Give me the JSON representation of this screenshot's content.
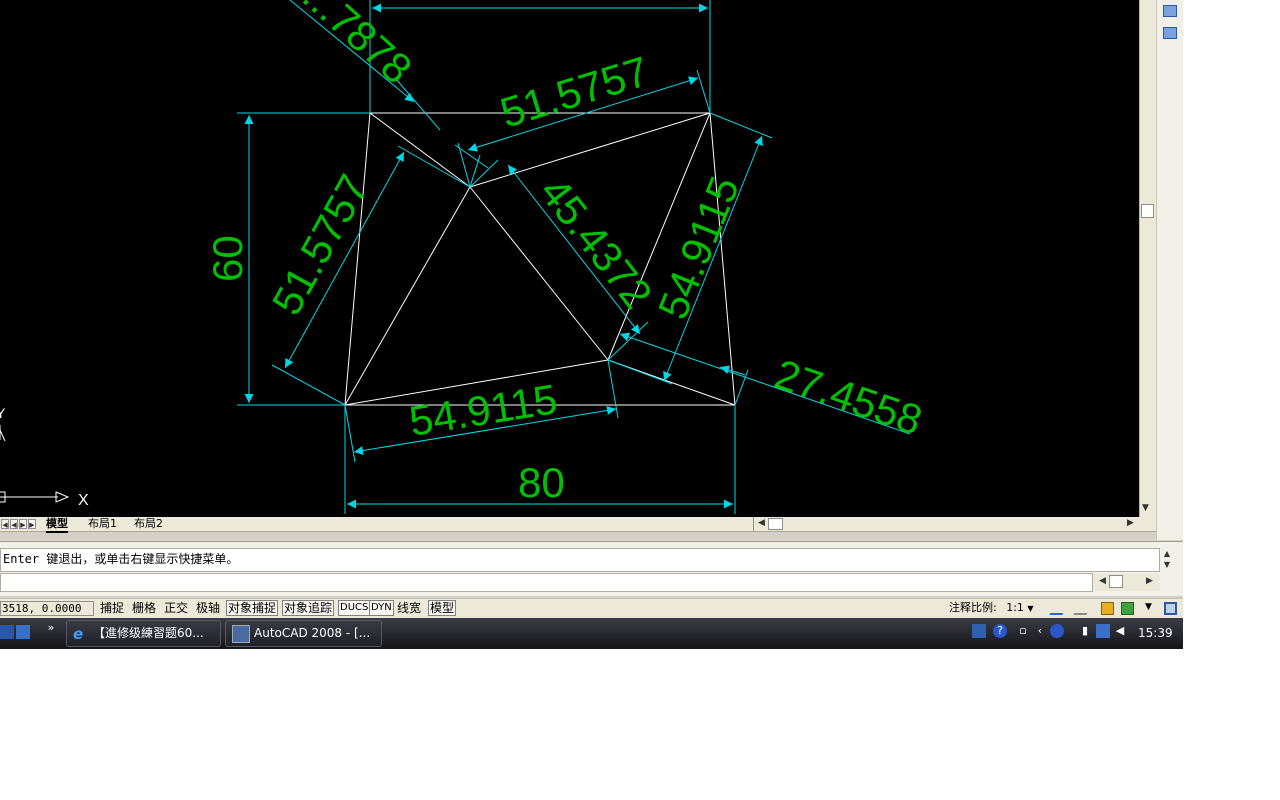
{
  "drawing": {
    "dimensions": {
      "top_partial": "...7878",
      "top_diagonal": "51.5757",
      "left_vertical": "60",
      "left_diagonal": "51.5757",
      "center_diagonal": "45.4372",
      "right_diagonal": "54.9115",
      "right_outer": "27.4558",
      "bottom_diagonal": "54.9115",
      "bottom_width": "80"
    },
    "ucs_x_label": "X",
    "ucs_y_label": "Y"
  },
  "layout_tabs": [
    "模型",
    "布局1",
    "布局2"
  ],
  "command": {
    "line1": "Enter 键退出，或单击右键显示快捷菜单。",
    "line2": ""
  },
  "status": {
    "coordinates": "3518, 0.0000",
    "toggles": [
      {
        "label": "捕捉",
        "on": false
      },
      {
        "label": "栅格",
        "on": false
      },
      {
        "label": "正交",
        "on": false
      },
      {
        "label": "极轴",
        "on": false
      },
      {
        "label": "对象捕捉",
        "on": true
      },
      {
        "label": "对象追踪",
        "on": true
      },
      {
        "label": "DUCS",
        "on": true
      },
      {
        "label": "DYN",
        "on": true
      },
      {
        "label": "线宽",
        "on": false
      },
      {
        "label": "模型",
        "on": true
      }
    ],
    "annotation_scale_label": "注释比例:",
    "annotation_scale_value": "1:1"
  },
  "taskbar": {
    "overflow": "»",
    "tasks": [
      {
        "label": "【進修级練習题60..."
      },
      {
        "label": "AutoCAD 2008 - [..."
      }
    ],
    "clock": "15:39"
  },
  "colors": {
    "dimension_line": "#00d7e6",
    "dimension_text": "#00c000",
    "geometry": "#ffffff",
    "canvas": "#000000"
  }
}
